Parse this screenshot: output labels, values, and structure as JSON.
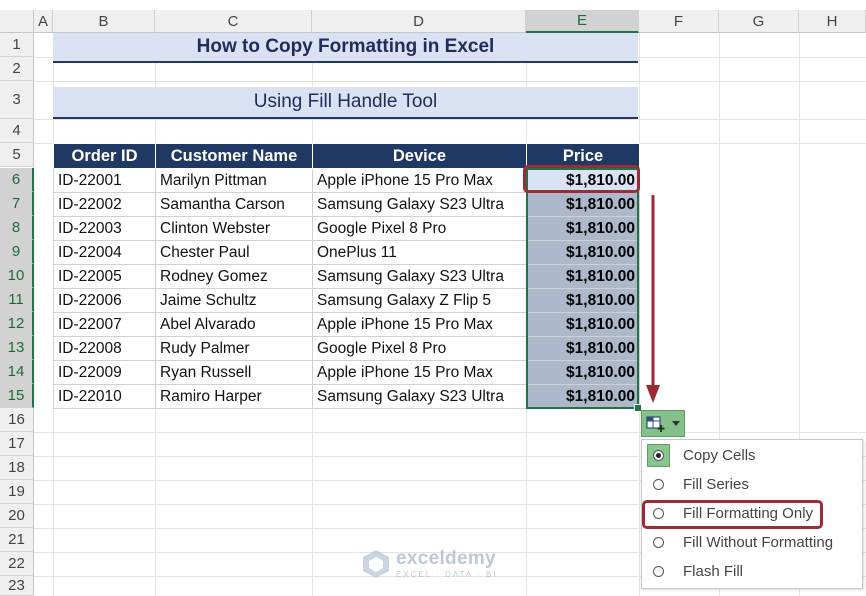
{
  "columns": [
    "A",
    "B",
    "C",
    "D",
    "E",
    "F",
    "G",
    "H"
  ],
  "selected_column": "E",
  "rows": [
    "1",
    "2",
    "3",
    "4",
    "5",
    "6",
    "7",
    "8",
    "9",
    "10",
    "11",
    "12",
    "13",
    "14",
    "15",
    "16",
    "17",
    "18",
    "19",
    "20",
    "21",
    "22",
    "23"
  ],
  "selected_rows": [
    "6",
    "7",
    "8",
    "9",
    "10",
    "11",
    "12",
    "13",
    "14",
    "15"
  ],
  "title": "How to Copy Formatting in Excel",
  "subtitle": "Using Fill Handle Tool",
  "table": {
    "headers": [
      "Order ID",
      "Customer Name",
      "Device",
      "Price"
    ],
    "rows": [
      [
        "ID-22001",
        "Marilyn Pittman",
        "Apple iPhone 15 Pro Max",
        "$1,810.00"
      ],
      [
        "ID-22002",
        "Samantha Carson",
        "Samsung Galaxy S23 Ultra",
        "$1,810.00"
      ],
      [
        "ID-22003",
        "Clinton Webster",
        "Google Pixel 8 Pro",
        "$1,810.00"
      ],
      [
        "ID-22004",
        "Chester Paul",
        "OnePlus 11",
        "$1,810.00"
      ],
      [
        "ID-22005",
        "Rodney Gomez",
        "Samsung Galaxy S23 Ultra",
        "$1,810.00"
      ],
      [
        "ID-22006",
        "Jaime Schultz",
        "Samsung Galaxy Z Flip 5",
        "$1,810.00"
      ],
      [
        "ID-22007",
        "Abel Alvarado",
        "Apple iPhone 15 Pro Max",
        "$1,810.00"
      ],
      [
        "ID-22008",
        "Rudy Palmer",
        "Google Pixel 8 Pro",
        "$1,810.00"
      ],
      [
        "ID-22009",
        "Ryan Russell",
        "Apple iPhone 15 Pro Max",
        "$1,810.00"
      ],
      [
        "ID-22010",
        "Ramiro Harper",
        "Samsung Galaxy S23 Ultra",
        "$1,810.00"
      ]
    ]
  },
  "autofill": {
    "button_icon": "autofill-options-icon",
    "dropdown_icon": "chevron-down-icon",
    "options": [
      {
        "label": "Copy Cells",
        "checked": true
      },
      {
        "label": "Fill Series",
        "checked": false
      },
      {
        "label": "Fill Formatting Only",
        "checked": false
      },
      {
        "label": "Fill Without Formatting",
        "checked": false
      },
      {
        "label": "Flash Fill",
        "checked": false
      }
    ],
    "highlighted_option": "Fill Formatting Only"
  },
  "watermark": {
    "name": "exceldemy",
    "tagline": "EXCEL · DATA · BI"
  },
  "colors": {
    "header_bg": "#203864",
    "banner_bg": "#d9e1f2",
    "price_fill": "#adb9ca",
    "first_price_fill": "#dae3f3",
    "annotation_red": "#9e2a36",
    "excel_green": "#217346"
  }
}
